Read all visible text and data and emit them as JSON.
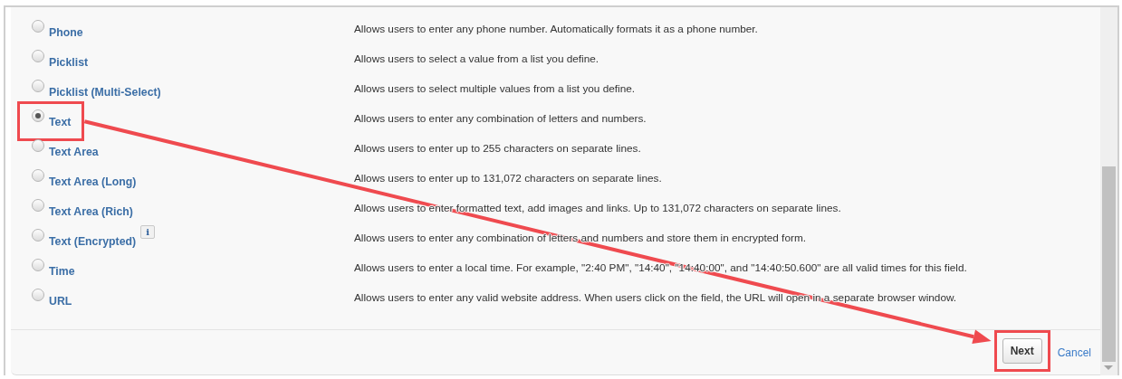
{
  "options": [
    {
      "label": "Phone",
      "description": "Allows users to enter any phone number. Automatically formats it as a phone number.",
      "selected": false
    },
    {
      "label": "Picklist",
      "description": "Allows users to select a value from a list you define.",
      "selected": false
    },
    {
      "label": "Picklist (Multi-Select)",
      "description": "Allows users to select multiple values from a list you define.",
      "selected": false
    },
    {
      "label": "Text",
      "description": "Allows users to enter any combination of letters and numbers.",
      "selected": true,
      "highlighted": true
    },
    {
      "label": "Text Area",
      "description": "Allows users to enter up to 255 characters on separate lines.",
      "selected": false
    },
    {
      "label": "Text Area (Long)",
      "description": "Allows users to enter up to 131,072 characters on separate lines.",
      "selected": false
    },
    {
      "label": "Text Area (Rich)",
      "description": "Allows users to enter formatted text, add images and links. Up to 131,072 characters on separate lines.",
      "selected": false
    },
    {
      "label": "Text (Encrypted)",
      "info": "i",
      "description": "Allows users to enter any combination of letters and numbers and store them in encrypted form.",
      "selected": false
    },
    {
      "label": "Time",
      "description": "Allows users to enter a local time. For example, \"2:40 PM\", \"14:40\", \"14:40:00\", and \"14:40:50.600\" are all valid times for this field.",
      "selected": false
    },
    {
      "label": "URL",
      "description": "Allows users to enter any valid website address. When users click on the field, the URL will open in a separate browser window.",
      "selected": false
    }
  ],
  "buttons": [
    {
      "label": "Next",
      "kind": "button",
      "highlighted": true
    },
    {
      "label": "Cancel",
      "kind": "link",
      "highlighted": false
    }
  ],
  "annotation_arrow": true
}
